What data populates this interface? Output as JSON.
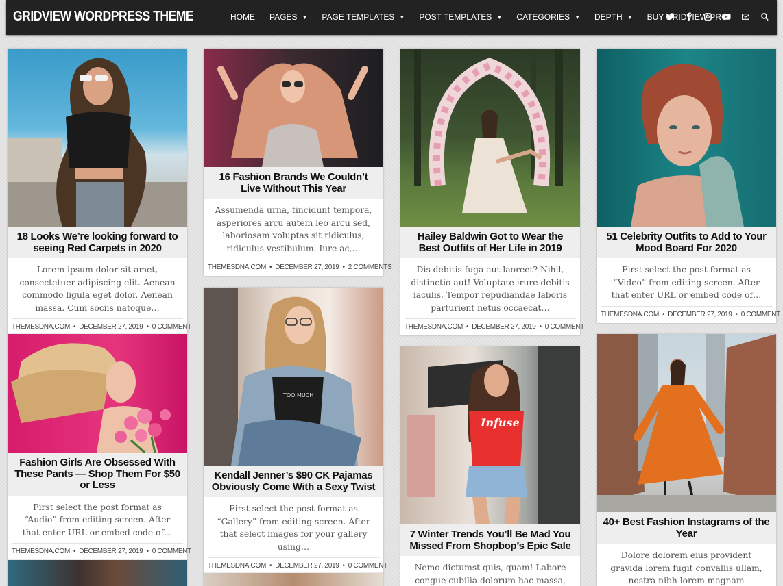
{
  "header": {
    "site_title": "GRIDVIEW WORDPRESS THEME",
    "nav": [
      {
        "label": "HOME",
        "dropdown": false
      },
      {
        "label": "PAGES",
        "dropdown": true
      },
      {
        "label": "PAGE TEMPLATES",
        "dropdown": true
      },
      {
        "label": "POST TEMPLATES",
        "dropdown": true
      },
      {
        "label": "CATEGORIES",
        "dropdown": true
      },
      {
        "label": "DEPTH",
        "dropdown": true
      },
      {
        "label": "BUY GRIDVIEW PRO",
        "dropdown": false
      }
    ],
    "social_icons": [
      "twitter-icon",
      "facebook-icon",
      "instagram-icon",
      "youtube-icon",
      "email-icon",
      "search-icon"
    ]
  },
  "posts": [
    {
      "title": "18 Looks We’re looking forward to seeing Red Carpets in 2020",
      "excerpt": "Lorem ipsum dolor sit amet, consectetuer adipiscing elit. Aenean commodo ligula eget dolor. Aenean massa. Cum sociis natoque…",
      "site": "THEMESDNA.COM",
      "date": "DECEMBER 27, 2019",
      "comments": "0 COMMENT"
    },
    {
      "title": "16 Fashion Brands We Couldn’t Live Without This Year",
      "excerpt": "Assumenda urna, tincidunt tempora, asperiores arcu autem leo arcu sed, laboriosam voluptas sit ridiculus, ridiculus vestibulum. Iure ac,…",
      "site": "THEMESDNA.COM",
      "date": "DECEMBER 27, 2019",
      "comments": "2 COMMENTS"
    },
    {
      "title": "Hailey Baldwin Got to Wear the Best Outfits of Her Life in 2019",
      "excerpt": "Dis debitis fuga aut laoreet? Nihil, distinctio aut! Voluptate irure debitis iaculis. Tempor repudiandae laboris parturient netus occaecat…",
      "site": "THEMESDNA.COM",
      "date": "DECEMBER 27, 2019",
      "comments": "0 COMMENT"
    },
    {
      "title": "51 Celebrity Outfits to Add to Your Mood Board For 2020",
      "excerpt": "First select the post format as “Video” from editing screen. After that enter URL or embed code of…",
      "site": "THEMESDNA.COM",
      "date": "DECEMBER 27, 2019",
      "comments": "0 COMMENT"
    },
    {
      "title": "Fashion Girls Are Obsessed With These Pants — Shop Them For $50 or Less",
      "excerpt": "First select the post format as “Audio” from editing screen. After that enter URL or embed code of…",
      "site": "THEMESDNA.COM",
      "date": "DECEMBER 27, 2019",
      "comments": "0 COMMENT"
    },
    {
      "title": "Kendall Jenner’s $90 CK Pajamas Obviously Come With a Sexy Twist",
      "excerpt": "First select the post format as “Gallery” from editing screen. After that select images for your gallery using…",
      "site": "THEMESDNA.COM",
      "date": "DECEMBER 27, 2019",
      "comments": "0 COMMENT"
    },
    {
      "title": "7 Winter Trends You’ll Be Mad You Missed From Shopbop’s Epic Sale",
      "excerpt": "Nemo dictumst quis, quam! Labore congue cubilia dolorum hac massa, porta,",
      "site": "",
      "date": "",
      "comments": ""
    },
    {
      "title": "40+ Best Fashion Instagrams of the Year",
      "excerpt": "Dolore dolorem eius provident gravida lorem fugit convallis ullam, nostra nibh lorem magnam molestiae? Rerum nihil aut? Cillum…",
      "site": "",
      "date": "",
      "comments": ""
    }
  ],
  "shirt_text": "Infuse",
  "tee_text": "TOO MUCH"
}
